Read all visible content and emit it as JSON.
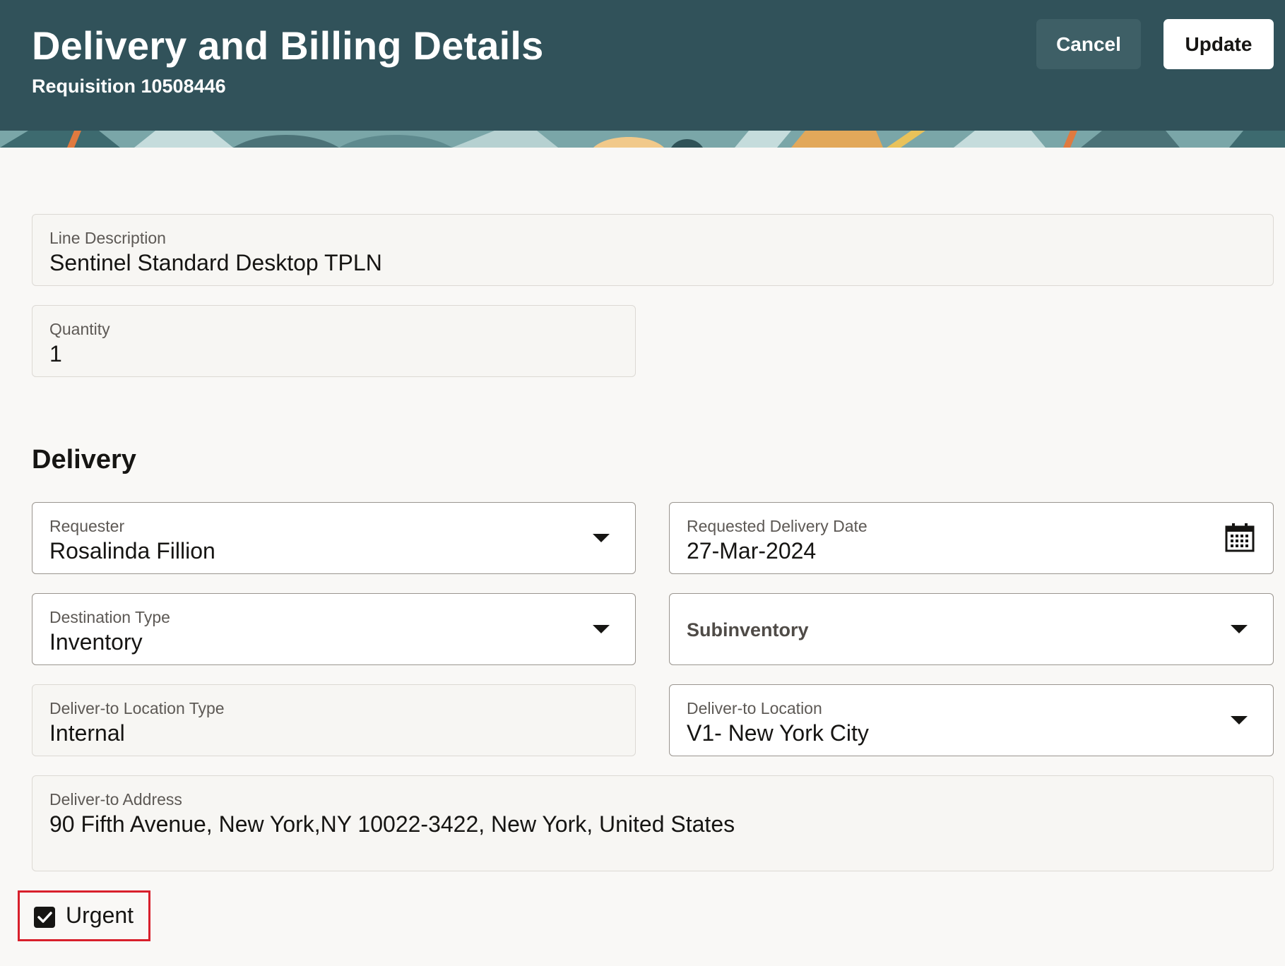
{
  "header": {
    "title": "Delivery and Billing Details",
    "subtitle": "Requisition 10508446",
    "cancel_label": "Cancel",
    "update_label": "Update",
    "background_color": "#31525a"
  },
  "line": {
    "description_label": "Line Description",
    "description_value": "Sentinel Standard Desktop TPLN",
    "quantity_label": "Quantity",
    "quantity_value": "1"
  },
  "delivery": {
    "section_title": "Delivery",
    "requester_label": "Requester",
    "requester_value": "Rosalinda Fillion",
    "date_label": "Requested Delivery Date",
    "date_value": "27-Mar-2024",
    "destination_type_label": "Destination Type",
    "destination_type_value": "Inventory",
    "subinventory_label": "Subinventory",
    "location_type_label": "Deliver-to Location Type",
    "location_type_value": "Internal",
    "location_label": "Deliver-to Location",
    "location_value": "V1- New York City",
    "address_label": "Deliver-to Address",
    "address_value": "90 Fifth Avenue, New York,NY 10022-3422, New York, United States",
    "urgent_label": "Urgent",
    "urgent_checked": true
  },
  "colors": {
    "highlight": "#d8202c"
  }
}
